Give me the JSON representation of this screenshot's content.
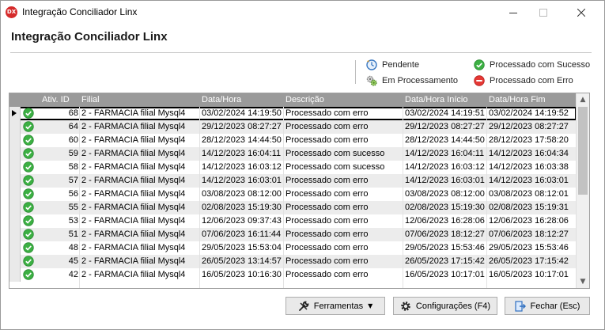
{
  "window": {
    "title": "Integração Conciliador Linx",
    "icon_text": "DX"
  },
  "heading": "Integração Conciliador Linx",
  "legend": [
    {
      "label": "Pendente",
      "icon": "clock-icon"
    },
    {
      "label": "Em Processamento",
      "icon": "gears-icon"
    },
    {
      "label": "Processado com Sucesso",
      "icon": "check-circle-icon",
      "color": "#3cb043"
    },
    {
      "label": "Processado com Erro",
      "icon": "minus-circle-icon",
      "color": "#e53935"
    }
  ],
  "grid": {
    "columns": [
      "Ativ. ID",
      "Filial",
      "Data/Hora",
      "Descrição",
      "Data/Hora Início",
      "Data/Hora Fim"
    ],
    "rows": [
      {
        "id": "68",
        "filial": "2 - FARMACIA  filial Mysql4",
        "dh": "03/02/2024 14:19:50",
        "desc": "Processado com erro",
        "ini": "03/02/2024 14:19:51",
        "fim": "03/02/2024 14:19:52"
      },
      {
        "id": "64",
        "filial": "2 - FARMACIA  filial Mysql4",
        "dh": "29/12/2023 08:27:27",
        "desc": "Processado com erro",
        "ini": "29/12/2023 08:27:27",
        "fim": "29/12/2023 08:27:27"
      },
      {
        "id": "60",
        "filial": "2 - FARMACIA  filial Mysql4",
        "dh": "28/12/2023 14:44:50",
        "desc": "Processado com erro",
        "ini": "28/12/2023 14:44:50",
        "fim": "28/12/2023 17:58:20"
      },
      {
        "id": "59",
        "filial": "2 - FARMACIA  filial Mysql4",
        "dh": "14/12/2023 16:04:11",
        "desc": "Processado com sucesso",
        "ini": "14/12/2023 16:04:11",
        "fim": "14/12/2023 16:04:34"
      },
      {
        "id": "58",
        "filial": "2 - FARMACIA  filial Mysql4",
        "dh": "14/12/2023 16:03:12",
        "desc": "Processado com sucesso",
        "ini": "14/12/2023 16:03:12",
        "fim": "14/12/2023 16:03:38"
      },
      {
        "id": "57",
        "filial": "2 - FARMACIA  filial Mysql4",
        "dh": "14/12/2023 16:03:01",
        "desc": "Processado com erro",
        "ini": "14/12/2023 16:03:01",
        "fim": "14/12/2023 16:03:01"
      },
      {
        "id": "56",
        "filial": "2 - FARMACIA  filial Mysql4",
        "dh": "03/08/2023 08:12:00",
        "desc": "Processado com erro",
        "ini": "03/08/2023 08:12:00",
        "fim": "03/08/2023 08:12:01"
      },
      {
        "id": "55",
        "filial": "2 - FARMACIA  filial Mysql4",
        "dh": "02/08/2023 15:19:30",
        "desc": "Processado com erro",
        "ini": "02/08/2023 15:19:30",
        "fim": "02/08/2023 15:19:31"
      },
      {
        "id": "53",
        "filial": "2 - FARMACIA  filial Mysql4",
        "dh": "12/06/2023 09:37:43",
        "desc": "Processado com erro",
        "ini": "12/06/2023 16:28:06",
        "fim": "12/06/2023 16:28:06"
      },
      {
        "id": "51",
        "filial": "2 - FARMACIA  filial Mysql4",
        "dh": "07/06/2023 16:11:44",
        "desc": "Processado com erro",
        "ini": "07/06/2023 18:12:27",
        "fim": "07/06/2023 18:12:27"
      },
      {
        "id": "48",
        "filial": "2 - FARMACIA  filial Mysql4",
        "dh": "29/05/2023 15:53:04",
        "desc": "Processado com erro",
        "ini": "29/05/2023 15:53:46",
        "fim": "29/05/2023 15:53:46"
      },
      {
        "id": "45",
        "filial": "2 - FARMACIA  filial Mysql4",
        "dh": "26/05/2023 13:14:57",
        "desc": "Processado com erro",
        "ini": "26/05/2023 17:15:42",
        "fim": "26/05/2023 17:15:42"
      },
      {
        "id": "42",
        "filial": "2 - FARMACIA  filial Mysql4",
        "dh": "16/05/2023 10:16:30",
        "desc": "Processado com erro",
        "ini": "16/05/2023 10:17:01",
        "fim": "16/05/2023 10:17:01"
      }
    ]
  },
  "buttons": {
    "tools": "Ferramentas",
    "config": "Configurações (F4)",
    "close": "Fechar (Esc)"
  }
}
